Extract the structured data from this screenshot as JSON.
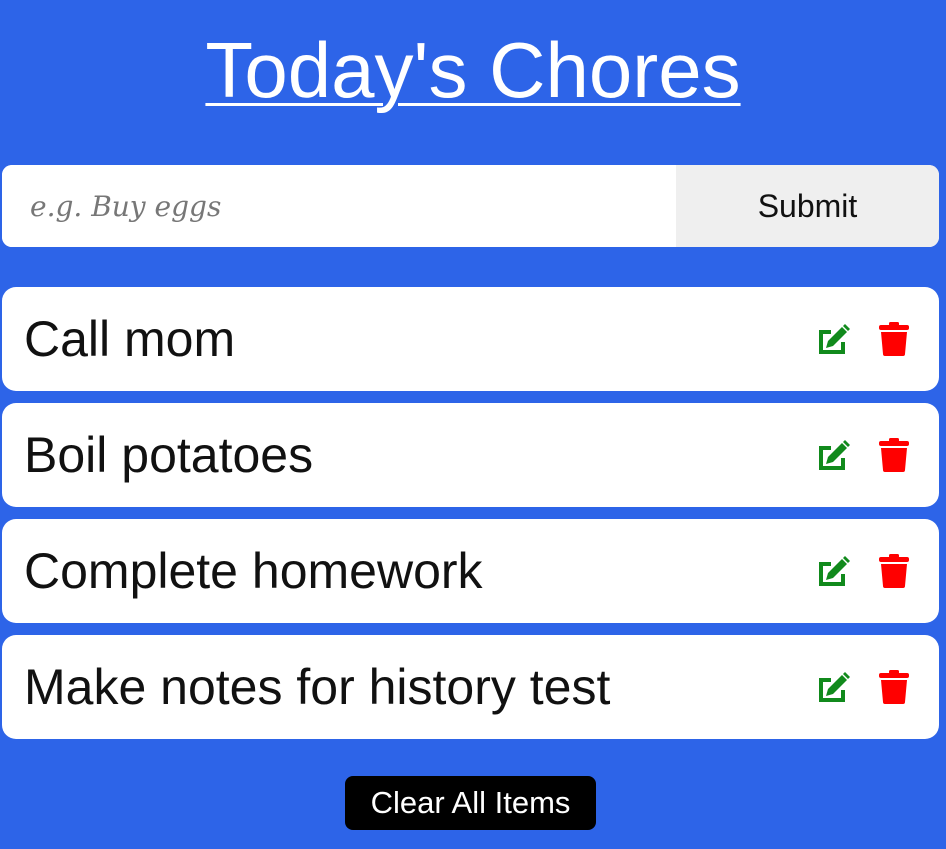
{
  "header": {
    "title": "Today's Chores"
  },
  "form": {
    "input_placeholder": "e.g. Buy eggs",
    "input_value": "",
    "submit_label": "Submit"
  },
  "items": [
    {
      "label": "Call mom"
    },
    {
      "label": "Boil potatoes"
    },
    {
      "label": "Complete homework"
    },
    {
      "label": "Make notes for history test"
    }
  ],
  "footer": {
    "clear_label": "Clear All Items"
  },
  "colors": {
    "background": "#2d64e8",
    "edit_icon": "#118a1c",
    "delete_icon": "#ff0000",
    "clear_button": "#000000"
  },
  "icons": {
    "edit": "edit-icon",
    "delete": "trash-icon"
  }
}
